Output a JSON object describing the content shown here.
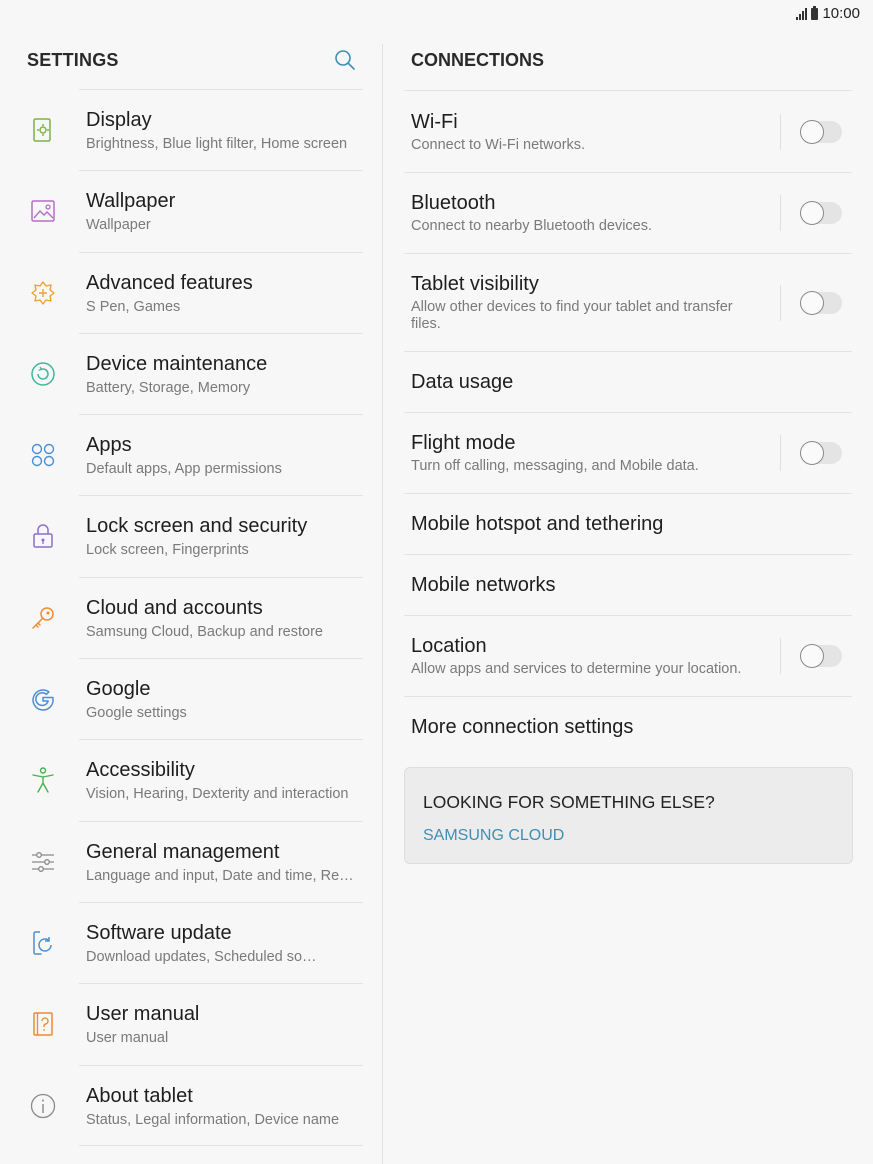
{
  "status": {
    "time": "10:00"
  },
  "left": {
    "header": "SETTINGS",
    "items": [
      {
        "title": "Display",
        "subtitle": "Brightness, Blue light filter, Home screen",
        "icon": "display-icon"
      },
      {
        "title": "Wallpaper",
        "subtitle": "Wallpaper",
        "icon": "wallpaper-icon"
      },
      {
        "title": "Advanced features",
        "subtitle": "S Pen, Games",
        "icon": "advanced-features-icon"
      },
      {
        "title": "Device maintenance",
        "subtitle": "Battery, Storage, Memory",
        "icon": "device-maintenance-icon"
      },
      {
        "title": "Apps",
        "subtitle": "Default apps, App permissions",
        "icon": "apps-icon"
      },
      {
        "title": "Lock screen and security",
        "subtitle": "Lock screen, Fingerprints",
        "icon": "lock-icon"
      },
      {
        "title": "Cloud and accounts",
        "subtitle": "Samsung Cloud, Backup and restore",
        "icon": "key-icon"
      },
      {
        "title": "Google",
        "subtitle": "Google settings",
        "icon": "google-icon"
      },
      {
        "title": "Accessibility",
        "subtitle": "Vision, Hearing, Dexterity and interaction",
        "icon": "accessibility-icon"
      },
      {
        "title": "General management",
        "subtitle": "Language and input, Date and time, Res…",
        "icon": "sliders-icon"
      },
      {
        "title": "Software update",
        "subtitle": "Download updates, Scheduled so…",
        "icon": "software-update-icon"
      },
      {
        "title": "User manual",
        "subtitle": "User manual",
        "icon": "user-manual-icon"
      },
      {
        "title": "About tablet",
        "subtitle": "Status, Legal information, Device name",
        "icon": "info-icon"
      }
    ]
  },
  "right": {
    "header": "CONNECTIONS",
    "items": [
      {
        "title": "Wi-Fi",
        "subtitle": "Connect to Wi-Fi networks.",
        "toggle": "off"
      },
      {
        "title": "Bluetooth",
        "subtitle": "Connect to nearby Bluetooth devices.",
        "toggle": "off"
      },
      {
        "title": "Tablet visibility",
        "subtitle": "Allow other devices to find your tablet and transfer files.",
        "toggle": "off"
      },
      {
        "title": "Data usage"
      },
      {
        "title": "Flight mode",
        "subtitle": "Turn off calling, messaging, and Mobile data.",
        "toggle": "off"
      },
      {
        "title": "Mobile hotspot and tethering"
      },
      {
        "title": "Mobile networks"
      },
      {
        "title": "Location",
        "subtitle": "Allow apps and services to determine your location.",
        "toggle": "off"
      },
      {
        "title": "More connection settings"
      }
    ],
    "card": {
      "title": "LOOKING FOR SOMETHING ELSE?",
      "link": "SAMSUNG CLOUD"
    }
  },
  "colors": {
    "accent": "#3d8fb8",
    "background": "#f7f7f7"
  }
}
